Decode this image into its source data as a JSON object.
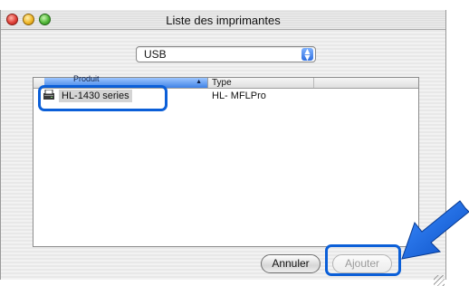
{
  "window": {
    "title": "Liste des imprimantes"
  },
  "popup": {
    "selected": "USB",
    "arrows_icon": "up-down-arrows-icon"
  },
  "list": {
    "columns": [
      "Produit",
      "Type"
    ],
    "sort_indicator": "▲",
    "rows": [
      {
        "name": "HL-1430 series",
        "type": "HL- MFLPro",
        "icon": "printer-icon"
      }
    ]
  },
  "buttons": {
    "cancel": "Annuler",
    "add": "Ajouter"
  },
  "colors": {
    "callout": "#0b5fd8",
    "selection_header": "#3f82e6"
  }
}
